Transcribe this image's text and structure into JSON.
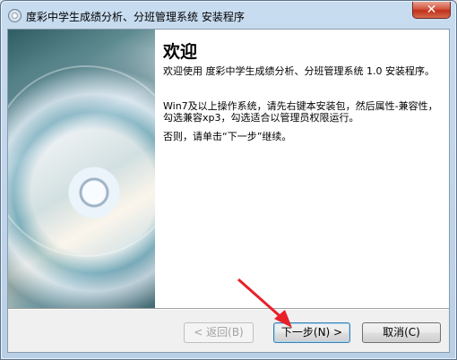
{
  "window": {
    "title": "度彩中学生成绩分析、分班管理系统 安装程序",
    "close_label": "✕"
  },
  "wizard": {
    "heading": "欢迎",
    "paragraphs": [
      "欢迎使用 度彩中学生成绩分析、分班管理系统 1.0 安装程序。",
      "Win7及以上操作系统，请先右键本安装包，然后属性-兼容性，勾选兼容xp3，勾选适合以管理员权限运行。",
      "否则，请单击“下一步”继续。"
    ]
  },
  "buttons": {
    "back": "< 返回(B)",
    "next": "下一步(N) >",
    "cancel": "取消(C)"
  },
  "colors": {
    "arrow": "#e8202a"
  }
}
